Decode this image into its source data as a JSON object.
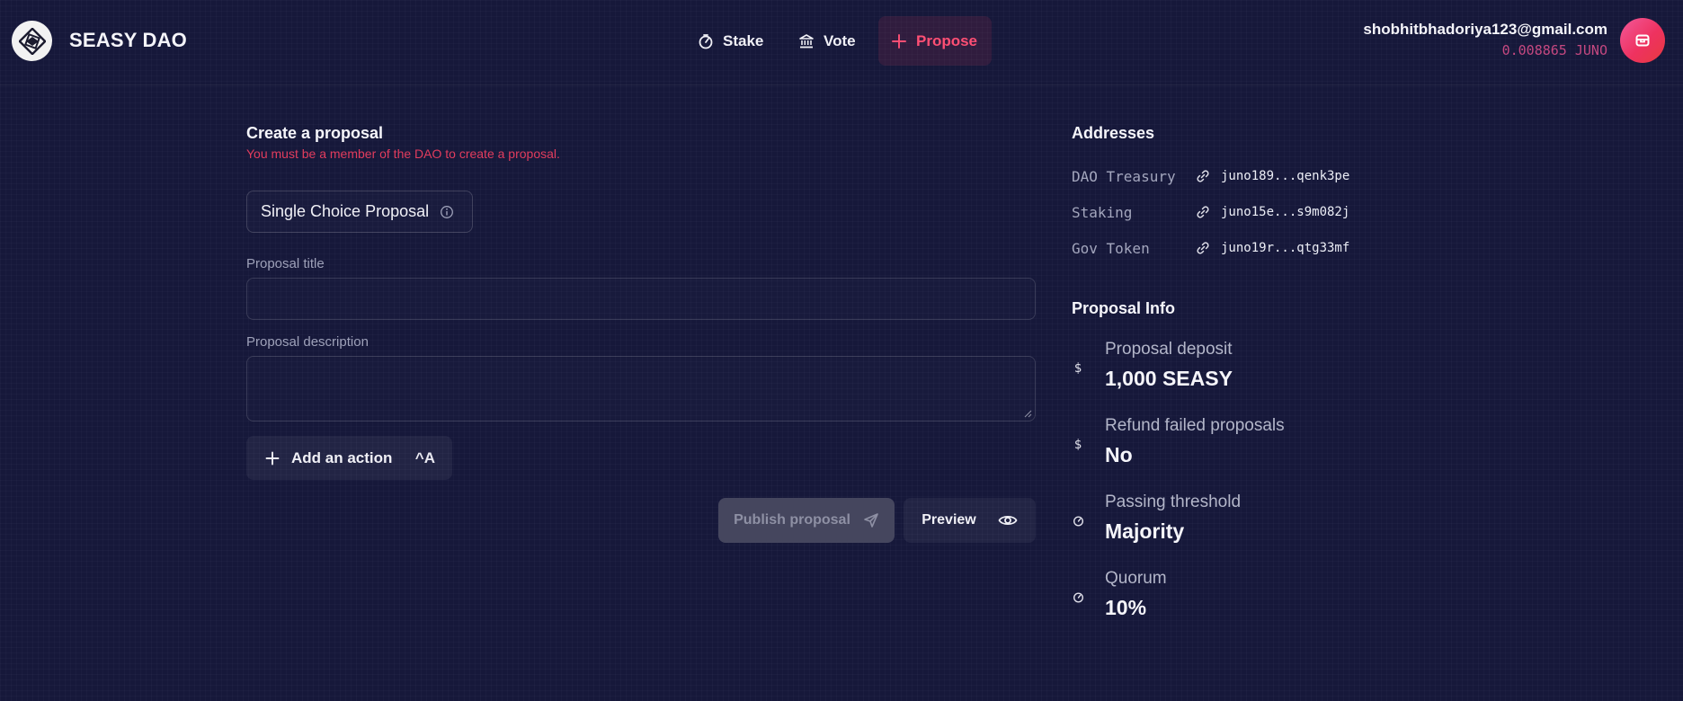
{
  "header": {
    "brand": "SEASY DAO",
    "nav": {
      "stake": "Stake",
      "vote": "Vote",
      "propose": "Propose"
    },
    "account": {
      "email": "shobhitbhadoriya123@gmail.com",
      "balance": "0.008865 JUNO"
    }
  },
  "form": {
    "title": "Create a proposal",
    "warning": "You must be a member of the DAO to create a proposal.",
    "proposal_type": "Single Choice Proposal",
    "title_label": "Proposal title",
    "title_value": "",
    "description_label": "Proposal description",
    "description_value": "",
    "add_action_label": "Add an action",
    "add_action_shortcut": "^A",
    "publish_label": "Publish proposal",
    "preview_label": "Preview"
  },
  "addresses": {
    "title": "Addresses",
    "items": [
      {
        "label": "DAO Treasury",
        "value": "juno189...qenk3pe"
      },
      {
        "label": "Staking",
        "value": "juno15e...s9m082j"
      },
      {
        "label": "Gov Token",
        "value": "juno19r...qtg33mf"
      }
    ]
  },
  "proposal_info": {
    "title": "Proposal Info",
    "items": [
      {
        "label": "Proposal deposit",
        "value": "1,000 SEASY",
        "icon": "dollar-icon"
      },
      {
        "label": "Refund failed proposals",
        "value": "No",
        "icon": "dollar-icon"
      },
      {
        "label": "Passing threshold",
        "value": "Majority",
        "icon": "gauge-icon"
      },
      {
        "label": "Quorum",
        "value": "10%",
        "icon": "gauge-icon"
      }
    ]
  },
  "colors": {
    "background": "#16183a",
    "accent": "#ff4f74",
    "warning": "#e23c5d",
    "balance": "#c54880"
  }
}
